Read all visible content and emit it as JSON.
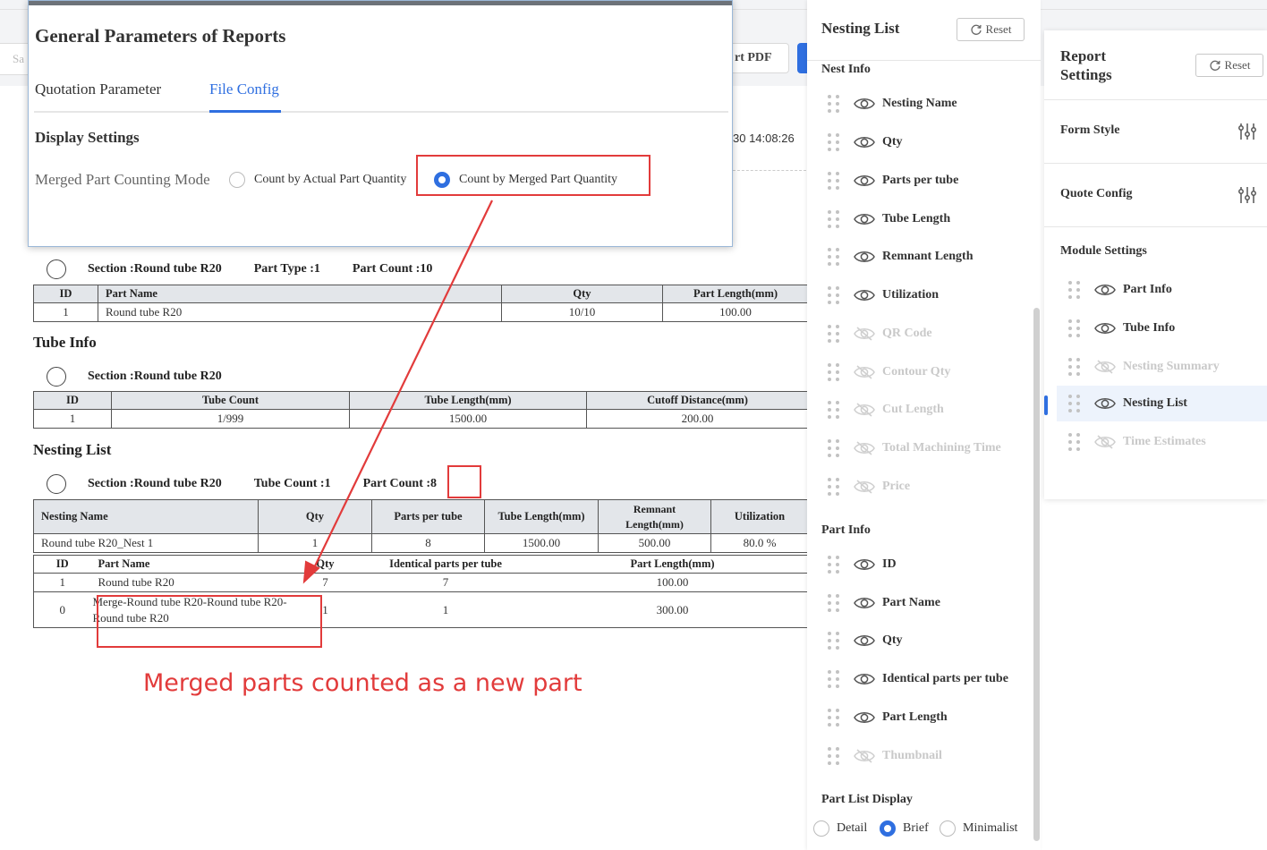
{
  "background": {
    "export_pdf_label": "rt PDF",
    "search_placeholder": "Sa",
    "timestamp": "30 14:08:26"
  },
  "modal": {
    "title": "General Parameters of Reports",
    "tabs": [
      "Quotation Parameter",
      "File Config"
    ],
    "active_tab": "File Config",
    "display_settings_title": "Display Settings",
    "merged_mode_label": "Merged Part Counting Mode",
    "options": [
      "Count by Actual Part Quantity",
      "Count by Merged Part Quantity"
    ],
    "selected_option": "Count by Merged Part Quantity"
  },
  "report": {
    "part_section": {
      "section": "Section :Round tube R20",
      "part_type": "Part Type :1",
      "part_count": "Part Count :10"
    },
    "part_table": {
      "headers": [
        "ID",
        "Part Name",
        "Qty",
        "Part Length(mm)"
      ],
      "rows": [
        [
          "1",
          "Round tube R20",
          "10/10",
          "100.00"
        ]
      ]
    },
    "tube_info_title": "Tube Info",
    "tube_section": "Section :Round tube R20",
    "tube_table": {
      "headers": [
        "ID",
        "Tube Count",
        "Tube Length(mm)",
        "Cutoff Distance(mm)"
      ],
      "rows": [
        [
          "1",
          "1/999",
          "1500.00",
          "200.00"
        ]
      ]
    },
    "nesting_list_title": "Nesting List",
    "nest_section": {
      "section": "Section :Round tube R20",
      "tube_count": "Tube Count :1",
      "part_count_label": "Part Count :",
      "part_count_value": "8"
    },
    "nest_table": {
      "headers": [
        "Nesting Name",
        "Qty",
        "Parts per tube",
        "Tube Length(mm)",
        "Remnant Length(mm)",
        "Utilization"
      ],
      "row": [
        "Round tube R20_Nest 1",
        "1",
        "8",
        "1500.00",
        "500.00",
        "80.0 %"
      ],
      "sub_headers": [
        "ID",
        "Part Name",
        "Qty",
        "Identical parts per tube",
        "Part Length(mm)"
      ],
      "sub_rows": [
        [
          "1",
          "Round tube R20",
          "7",
          "7",
          "100.00"
        ],
        [
          "0",
          "Merge-Round tube R20-Round tube R20-Round tube R20",
          "1",
          "1",
          "300.00"
        ]
      ]
    }
  },
  "annotation": "Merged parts counted as a new part",
  "nesting_panel": {
    "title": "Nesting List",
    "reset_label": "Reset",
    "nest_info_title": "Nest Info",
    "nest_info_items": [
      {
        "label": "Nesting Name",
        "visible": true
      },
      {
        "label": "Qty",
        "visible": true
      },
      {
        "label": "Parts per tube",
        "visible": true
      },
      {
        "label": "Tube Length",
        "visible": true
      },
      {
        "label": "Remnant Length",
        "visible": true
      },
      {
        "label": "Utilization",
        "visible": true
      },
      {
        "label": "QR Code",
        "visible": false
      },
      {
        "label": "Contour Qty",
        "visible": false
      },
      {
        "label": "Cut Length",
        "visible": false
      },
      {
        "label": "Total Machining Time",
        "visible": false
      },
      {
        "label": "Price",
        "visible": false
      }
    ],
    "part_info_title": "Part Info",
    "part_info_items": [
      {
        "label": "ID",
        "visible": true
      },
      {
        "label": "Part Name",
        "visible": true
      },
      {
        "label": "Qty",
        "visible": true
      },
      {
        "label": "Identical parts per tube",
        "visible": true
      },
      {
        "label": "Part Length",
        "visible": true
      },
      {
        "label": "Thumbnail",
        "visible": false
      }
    ],
    "part_list_display_title": "Part List Display",
    "part_list_options": [
      "Detail",
      "Brief",
      "Minimalist"
    ],
    "part_list_selected": "Brief"
  },
  "settings_panel": {
    "title": "Report Settings",
    "reset_label": "Reset",
    "form_style": "Form Style",
    "quote_config": "Quote Config",
    "module_settings_title": "Module Settings",
    "modules": [
      {
        "label": "Part Info",
        "visible": true
      },
      {
        "label": "Tube Info",
        "visible": true
      },
      {
        "label": "Nesting Summary",
        "visible": false
      },
      {
        "label": "Nesting List",
        "visible": true
      },
      {
        "label": "Time Estimates",
        "visible": false
      }
    ],
    "active_module": "Nesting List"
  },
  "colors": {
    "accent": "#2f6fe0",
    "annotation_red": "#e23b3b",
    "disabled": "#c9c9c9"
  }
}
